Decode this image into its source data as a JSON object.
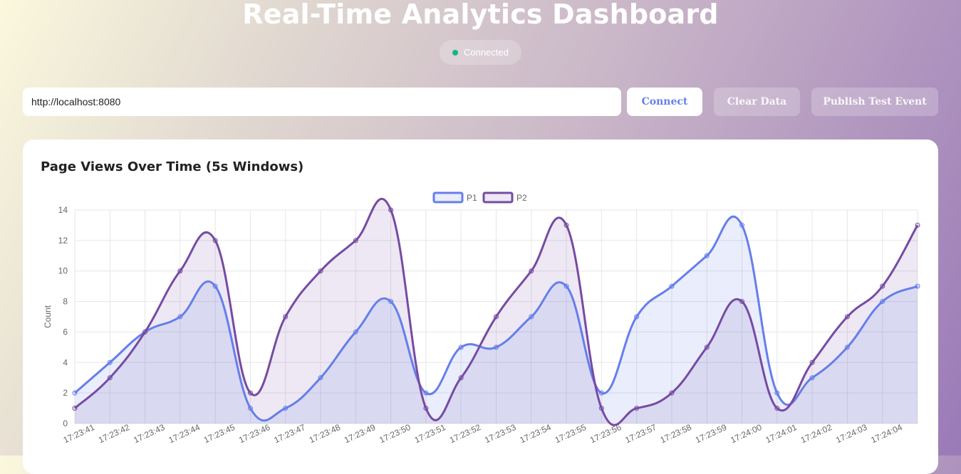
{
  "header": {
    "title": "Real-Time Analytics Dashboard",
    "status": "Connected",
    "status_color": "#10b981"
  },
  "controls": {
    "url_value": "http://localhost:8080",
    "connect_label": "Connect",
    "clear_label": "Clear Data",
    "publish_label": "Publish Test Event"
  },
  "card": {
    "title": "Page Views Over Time (5s Windows)"
  },
  "chart_data": {
    "type": "area",
    "x": [
      "17:23:41",
      "17:23:42",
      "17:23:43",
      "17:23:44",
      "17:23:45",
      "17:23:46",
      "17:23:47",
      "17:23:48",
      "17:23:49",
      "17:23:50",
      "17:23:51",
      "17:23:52",
      "17:23:53",
      "17:23:54",
      "17:23:55",
      "17:23:56",
      "17:23:57",
      "17:23:58",
      "17:23:59",
      "17:24:00",
      "17:24:01",
      "17:24:02",
      "17:24:03",
      "17:24:04"
    ],
    "series": [
      {
        "name": "P1",
        "color": "#667eea",
        "values": [
          2,
          4,
          6,
          7,
          9,
          1,
          1,
          3,
          6,
          8,
          2,
          5,
          5,
          7,
          9,
          2,
          7,
          9,
          11,
          13,
          2,
          3,
          5,
          8,
          9
        ]
      },
      {
        "name": "P2",
        "color": "#764ba2",
        "values": [
          1,
          3,
          6,
          10,
          12,
          2,
          7,
          10,
          12,
          14,
          1,
          3,
          7,
          10,
          13,
          1,
          1,
          2,
          5,
          8,
          1,
          4,
          7,
          9,
          13
        ]
      }
    ],
    "xlabel": "",
    "ylabel": "Count",
    "ylim": [
      0,
      14
    ],
    "yticks": [
      0,
      2,
      4,
      6,
      8,
      10,
      12,
      14
    ],
    "legend": "top-center",
    "grid": true
  }
}
